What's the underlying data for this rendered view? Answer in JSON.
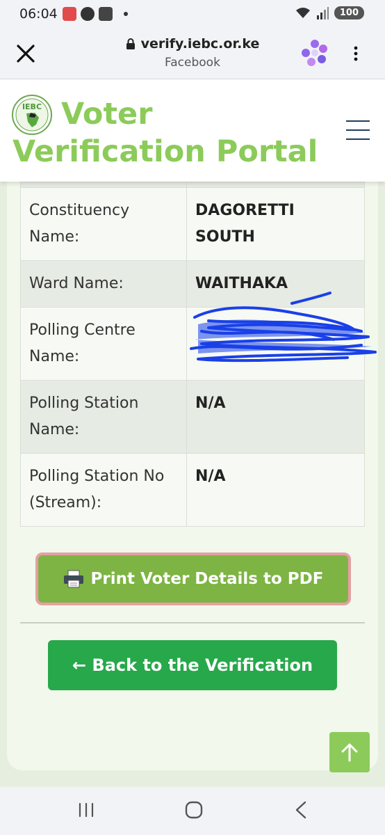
{
  "status_bar": {
    "time": "06:04",
    "battery": "100"
  },
  "browser": {
    "url": "verify.iebc.or.ke",
    "source": "Facebook"
  },
  "site": {
    "logo_text": "IEBC",
    "title": "Voter Verification Portal"
  },
  "details": [
    {
      "label": "Constituency Name:",
      "value": "DAGORETTI SOUTH"
    },
    {
      "label": "Ward Name:",
      "value": "WAITHAKA"
    },
    {
      "label": "Polling Centre Name:",
      "value": ""
    },
    {
      "label": "Polling Station Name:",
      "value": "N/A"
    },
    {
      "label": "Polling Station No (Stream):",
      "value": "N/A"
    }
  ],
  "actions": {
    "print_label": "Print Voter Details to PDF",
    "back_label": "← Back to the Verification"
  },
  "colors": {
    "brand_green": "#8ccb5a",
    "print_button": "#7db443",
    "back_button": "#27a84a",
    "redaction": "#1a40e8"
  }
}
